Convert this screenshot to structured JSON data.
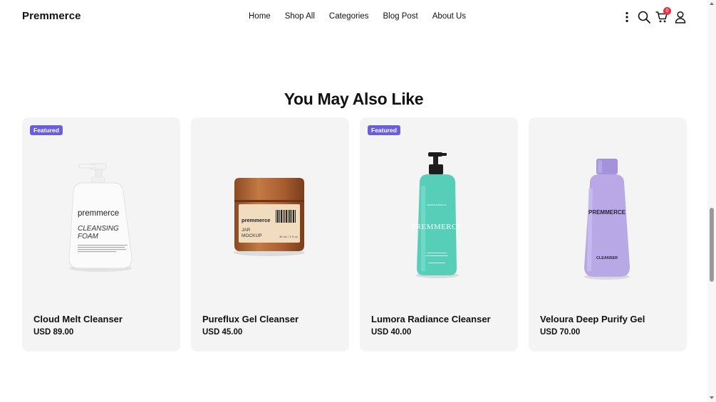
{
  "header": {
    "logo": "Premmerce",
    "nav": [
      "Home",
      "Shop All",
      "Categories",
      "Blog Post",
      "About Us"
    ],
    "cart_count": "0"
  },
  "section": {
    "title": "You May Also Like"
  },
  "products": [
    {
      "name": "Cloud Melt Cleanser",
      "price": "USD 89.00",
      "badge": "Featured",
      "label_brand": "premmerce",
      "label_line1": "CLEANSING",
      "label_line2": "FOAM"
    },
    {
      "name": "Pureflux Gel Cleanser",
      "price": "USD 45.00",
      "badge": "",
      "label_brand": "premmerce",
      "label_line1": "JAR",
      "label_line2": "MOCKUP",
      "label_size": "30 mL / 1 fl. oz"
    },
    {
      "name": "Lumora Radiance Cleanser",
      "price": "USD 40.00",
      "badge": "Featured",
      "label_brand": "PREMMERCE"
    },
    {
      "name": "Veloura Deep Purify Gel",
      "price": "USD 70.00",
      "badge": "",
      "label_brand": "PREMMERCE",
      "label_line1": "CLEANSER"
    }
  ],
  "colors": {
    "badge": "#6a5fd8",
    "card_bg": "#f4f4f4",
    "cart_badge": "#e53344",
    "teal_bottle": "#58d1b8",
    "lavender_bottle": "#b9a8e6",
    "wood_jar": "#b5693a"
  },
  "icons": [
    "more-vertical-icon",
    "search-icon",
    "cart-icon",
    "user-icon"
  ]
}
